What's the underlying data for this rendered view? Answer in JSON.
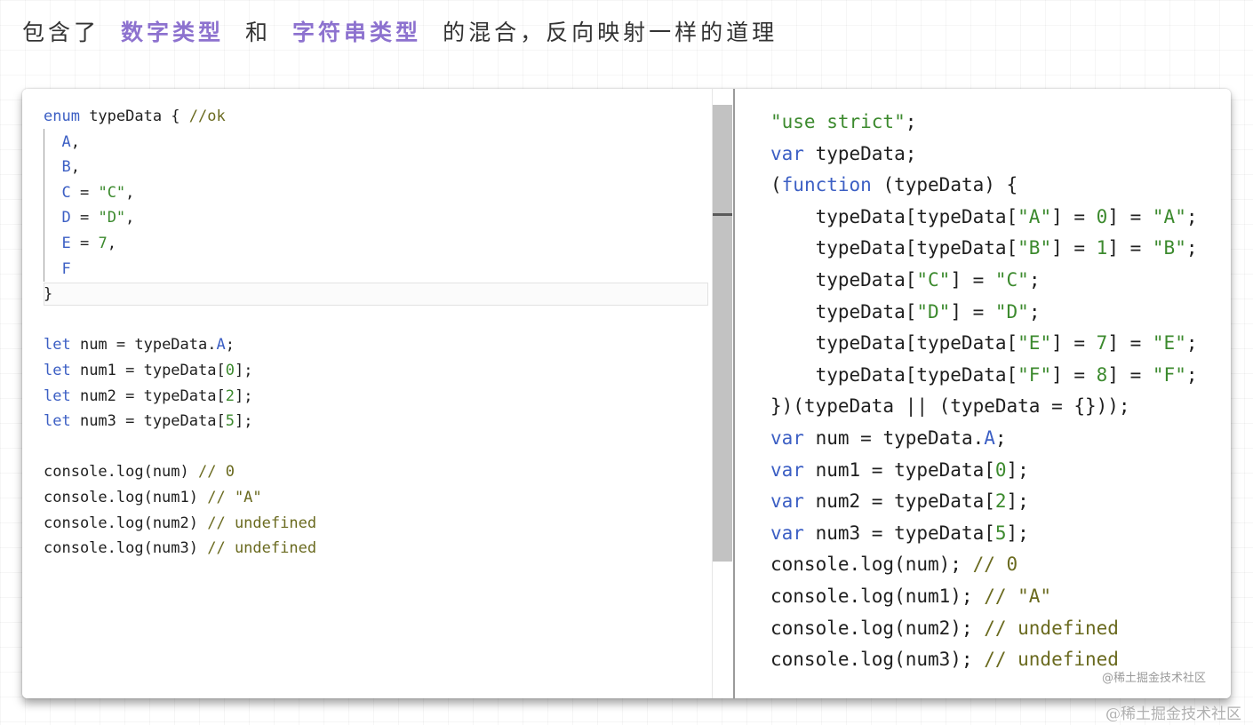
{
  "headline": {
    "prefix": "包含了",
    "term1": "数字类型",
    "middle": "和",
    "term2": "字符串类型",
    "suffix": "的混合，反向映射一样的道理"
  },
  "left_code": {
    "l1": {
      "kw": "enum",
      "name": " typeData { ",
      "cmt": "//ok"
    },
    "l2": {
      "prop": "A",
      "rest": ","
    },
    "l3": {
      "prop": "B",
      "rest": ","
    },
    "l4": {
      "prop": "C",
      "op": " = ",
      "str": "\"C\"",
      "rest": ","
    },
    "l5": {
      "prop": "D",
      "op": " = ",
      "str": "\"D\"",
      "rest": ","
    },
    "l6": {
      "prop": "E",
      "op": " = ",
      "num": "7",
      "rest": ","
    },
    "l7": {
      "prop": "F"
    },
    "l8": {
      "text": "}"
    },
    "l10": {
      "kw": "let",
      "a": " num = typeData.",
      "prop": "A",
      "b": ";"
    },
    "l11": {
      "kw": "let",
      "a": " num1 = typeData[",
      "num": "0",
      "b": "];"
    },
    "l12": {
      "kw": "let",
      "a": " num2 = typeData[",
      "num": "2",
      "b": "];"
    },
    "l13": {
      "kw": "let",
      "a": " num3 = typeData[",
      "num": "5",
      "b": "];"
    },
    "l15": {
      "a": "console.log(num) ",
      "cmt": "// 0"
    },
    "l16": {
      "a": "console.log(num1) ",
      "cmt": "// \"A\""
    },
    "l17": {
      "a": "console.log(num2) ",
      "cmt": "// undefined"
    },
    "l18": {
      "a": "console.log(num3) ",
      "cmt": "// undefined"
    }
  },
  "right_code": {
    "r1": {
      "str": "\"use strict\"",
      "b": ";"
    },
    "r2": {
      "kw": "var",
      "a": " typeData;"
    },
    "r3": {
      "a": "(",
      "kw": "function",
      "b": " (typeData) {"
    },
    "r4": {
      "a": "    typeData[typeData[",
      "s1": "\"A\"",
      "m": "] = ",
      "n": "0",
      "m2": "] = ",
      "s2": "\"A\"",
      "e": ";"
    },
    "r5": {
      "a": "    typeData[typeData[",
      "s1": "\"B\"",
      "m": "] = ",
      "n": "1",
      "m2": "] = ",
      "s2": "\"B\"",
      "e": ";"
    },
    "r6": {
      "a": "    typeData[",
      "s1": "\"C\"",
      "m": "] = ",
      "s2": "\"C\"",
      "e": ";"
    },
    "r7": {
      "a": "    typeData[",
      "s1": "\"D\"",
      "m": "] = ",
      "s2": "\"D\"",
      "e": ";"
    },
    "r8": {
      "a": "    typeData[typeData[",
      "s1": "\"E\"",
      "m": "] = ",
      "n": "7",
      "m2": "] = ",
      "s2": "\"E\"",
      "e": ";"
    },
    "r9": {
      "a": "    typeData[typeData[",
      "s1": "\"F\"",
      "m": "] = ",
      "n": "8",
      "m2": "] = ",
      "s2": "\"F\"",
      "e": ";"
    },
    "r10": {
      "a": "})(typeData || (typeData = {}));"
    },
    "r11": {
      "kw": "var",
      "a": " num = typeData.",
      "prop": "A",
      "b": ";"
    },
    "r12": {
      "kw": "var",
      "a": " num1 = typeData[",
      "num": "0",
      "b": "];"
    },
    "r13": {
      "kw": "var",
      "a": " num2 = typeData[",
      "num": "2",
      "b": "];"
    },
    "r14": {
      "kw": "var",
      "a": " num3 = typeData[",
      "num": "5",
      "b": "];"
    },
    "r15": {
      "a": "console.log(num); ",
      "cmt": "// 0"
    },
    "r16": {
      "a": "console.log(num1); ",
      "cmt": "// \"A\""
    },
    "r17": {
      "a": "console.log(num2); ",
      "cmt": "// undefined"
    },
    "r18": {
      "a": "console.log(num3); ",
      "cmt": "// undefined"
    }
  },
  "watermark": {
    "inner": "@稀土掘金技术社区",
    "outer": "@稀土掘金技术社区"
  },
  "colors": {
    "keyword": "#3c5fc4",
    "string": "#3c8a2e",
    "comment": "#6a6a1f",
    "highlight": "#8d72cf"
  }
}
